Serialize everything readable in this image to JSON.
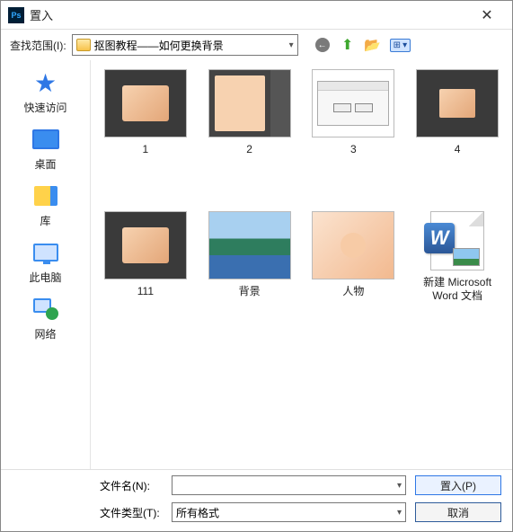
{
  "window": {
    "app_icon_text": "Ps",
    "title": "置入"
  },
  "lookin": {
    "label": "查找范围(I):",
    "folder_name": "抠图教程——如何更换背景"
  },
  "places": [
    {
      "id": "quick-access",
      "label": "快速访问"
    },
    {
      "id": "desktop",
      "label": "桌面"
    },
    {
      "id": "libraries",
      "label": "库"
    },
    {
      "id": "this-pc",
      "label": "此电脑"
    },
    {
      "id": "network",
      "label": "网络"
    }
  ],
  "files": [
    {
      "name": "1",
      "kind": "ps-thumb"
    },
    {
      "name": "2",
      "kind": "ps-full"
    },
    {
      "name": "3",
      "kind": "dialog"
    },
    {
      "name": "4",
      "kind": "ps-small"
    },
    {
      "name": "111",
      "kind": "ps-thumb"
    },
    {
      "name": "背景",
      "kind": "beach"
    },
    {
      "name": "人物",
      "kind": "person"
    },
    {
      "name": "新建 Microsoft Word 文档",
      "kind": "word"
    }
  ],
  "bottom": {
    "filename_label": "文件名(N):",
    "filename_value": "",
    "filetype_label": "文件类型(T):",
    "filetype_value": "所有格式",
    "place_btn": "置入(P)",
    "cancel_btn": "取消"
  }
}
